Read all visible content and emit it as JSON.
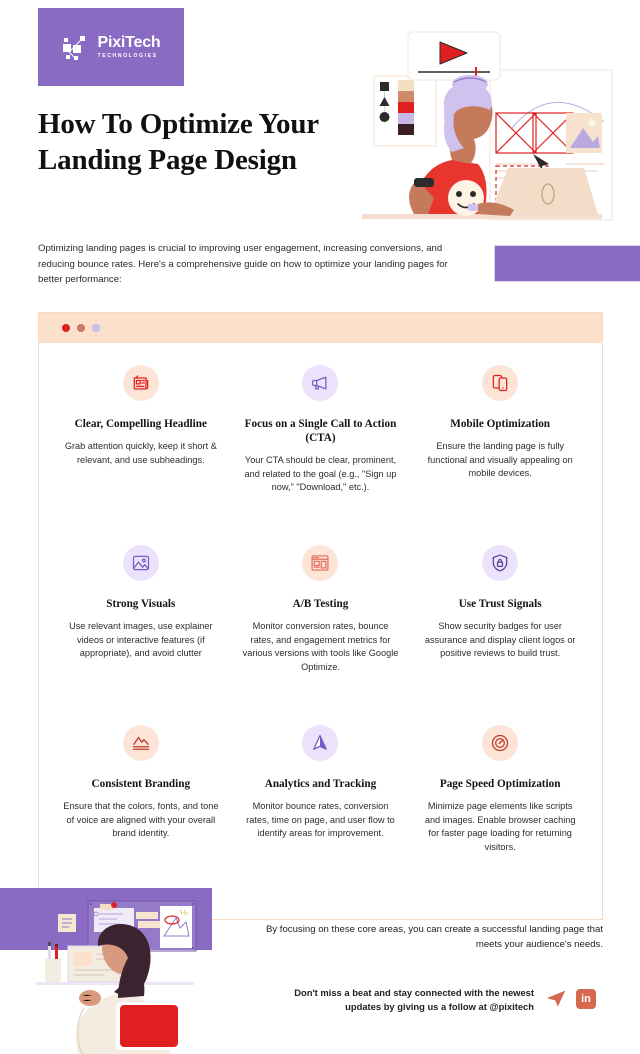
{
  "brand": {
    "name": "PixiTech",
    "tagline": "TECHNOLOGIES",
    "logo_icon": "network-nodes-icon",
    "purple": "#8a6bc4",
    "red": "#e02020",
    "peach": "#fbe0cb"
  },
  "header": {
    "title": "How To Optimize Your Landing Page Design",
    "intro": "Optimizing landing pages is crucial to improving user engagement, increasing conversions, and reducing bounce rates. Here's a comprehensive guide on how to optimize your landing pages for better performance:"
  },
  "panel": {
    "dots": [
      "red",
      "orange",
      "lilac"
    ],
    "cards": [
      {
        "icon": "newspaper-icon",
        "icon_theme": "peach",
        "title": "Clear, Compelling Headline",
        "body": "Grab attention quickly, keep it short & relevant, and use subheadings."
      },
      {
        "icon": "megaphone-icon",
        "icon_theme": "lilac",
        "title": "Focus on a Single Call to Action (CTA)",
        "body": "Your CTA should be clear, prominent, and related to the goal (e.g., \"Sign up now,\" \"Download,\" etc.)."
      },
      {
        "icon": "mobile-devices-icon",
        "icon_theme": "peach",
        "title": "Mobile Optimization",
        "body": "Ensure the landing page is fully functional and visually appealing on mobile devices."
      },
      {
        "icon": "image-picture-icon",
        "icon_theme": "lilac",
        "title": "Strong Visuals",
        "body": "Use relevant images, use explainer videos or interactive features (if appropriate), and avoid clutter"
      },
      {
        "icon": "ab-layout-icon",
        "icon_theme": "peach",
        "title": "A/B Testing",
        "body": "Monitor conversion rates, bounce rates, and engagement metrics for various versions with tools like Google Optimize."
      },
      {
        "icon": "shield-lock-icon",
        "icon_theme": "lilac",
        "title": "Use Trust Signals",
        "body": "Show security badges for user assurance and display client logos or positive reviews to build trust."
      },
      {
        "icon": "mountain-brand-icon",
        "icon_theme": "peach",
        "title": "Consistent Branding",
        "body": "Ensure that the colors, fonts, and tone of voice are aligned with your overall brand identity."
      },
      {
        "icon": "analytics-triangle-icon",
        "icon_theme": "lilac",
        "title": "Analytics and Tracking",
        "body": "Monitor bounce rates, conversion rates, time on page, and user flow to identify areas for improvement."
      },
      {
        "icon": "speedometer-icon",
        "icon_theme": "peach",
        "title": "Page Speed Optimization",
        "body": "Minimize page elements like scripts and images. Enable browser caching for faster page loading for returning visitors."
      }
    ]
  },
  "footer": {
    "closing": "By focusing on these core areas, you can create a successful landing page that meets your audience's needs.",
    "follow": "Don't miss a beat and stay connected with the newest updates by giving us a follow at @pixitech",
    "socials": [
      {
        "name": "telegram-icon",
        "glyph": ""
      },
      {
        "name": "linkedin-icon",
        "glyph": "in"
      }
    ]
  }
}
